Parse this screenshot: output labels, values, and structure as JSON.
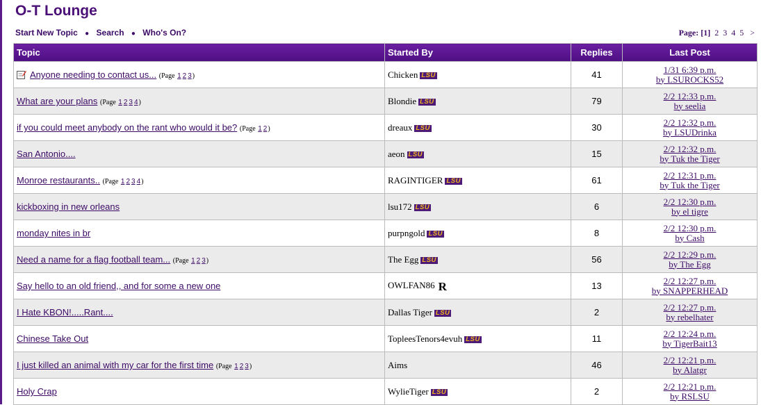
{
  "forum": {
    "title": "O-T Lounge"
  },
  "nav": {
    "start_new_topic": "Start New Topic",
    "search": "Search",
    "whos_on": "Who's On?",
    "separator": "●"
  },
  "pager": {
    "label": "Page:",
    "current": "[1]",
    "pages": [
      "2",
      "3",
      "4",
      "5"
    ],
    "next": ">"
  },
  "table": {
    "headers": {
      "topic": "Topic",
      "started_by": "Started By",
      "replies": "Replies",
      "last_post": "Last Post"
    }
  },
  "topics": [
    {
      "title": "Anyone needing to contact us...",
      "pages": [
        "1",
        "2",
        "3"
      ],
      "starter": "Chicken",
      "badge": "LSU",
      "replies": "41",
      "date": "1/31  6:39 p.m.",
      "by": "by LSUROCKS52",
      "icon": "note-pencil-icon"
    },
    {
      "title": "What are your plans",
      "pages": [
        "1",
        "2",
        "3",
        "4"
      ],
      "starter": "Blondie",
      "badge": "LSU",
      "replies": "79",
      "date": "2/2  12:33 p.m.",
      "by": "by seelia"
    },
    {
      "title": "if you could meet anybody on the rant who would it be?",
      "pages": [
        "1",
        "2"
      ],
      "starter": "dreaux",
      "badge": "LSU",
      "replies": "30",
      "date": "2/2  12:32 p.m.",
      "by": "by LSUDrinka"
    },
    {
      "title": "San Antonio....",
      "pages": [],
      "starter": "aeon",
      "badge": "LSU",
      "replies": "15",
      "date": "2/2  12:32 p.m.",
      "by": "by Tuk the Tiger"
    },
    {
      "title": "Monroe restaurants..",
      "pages": [
        "1",
        "2",
        "3",
        "4"
      ],
      "starter": "RAGINTIGER",
      "badge": "LSU",
      "replies": "61",
      "date": "2/2  12:31 p.m.",
      "by": "by Tuk the Tiger"
    },
    {
      "title": "kickboxing in new orleans",
      "pages": [],
      "starter": "lsu172",
      "badge": "LSU",
      "replies": "6",
      "date": "2/2  12:30 p.m.",
      "by": "by el tigre"
    },
    {
      "title": "monday nites in br",
      "pages": [],
      "starter": "purpngold",
      "badge": "LSU",
      "replies": "8",
      "date": "2/2  12:30 p.m.",
      "by": "by Cash"
    },
    {
      "title": "Need a name for a flag football team...",
      "pages": [
        "1",
        "2",
        "3"
      ],
      "starter": "The Egg",
      "badge": "LSU",
      "replies": "56",
      "date": "2/2  12:29 p.m.",
      "by": "by The Egg"
    },
    {
      "title": "Say hello to an old friend,, and for some a new one",
      "pages": [],
      "starter": "OWLFAN86",
      "badge": "R",
      "replies": "13",
      "date": "2/2  12:27 p.m.",
      "by": "by SNAPPERHEAD"
    },
    {
      "title": "I Hate KBON!.....Rant....",
      "pages": [],
      "starter": "Dallas Tiger",
      "badge": "LSU",
      "replies": "2",
      "date": "2/2  12:27 p.m.",
      "by": "by rebelhater"
    },
    {
      "title": "Chinese Take Out",
      "pages": [],
      "starter": "TopleesTenors4evuh",
      "badge": "LSU",
      "replies": "11",
      "date": "2/2  12:24 p.m.",
      "by": "by TigerBait13"
    },
    {
      "title": "I just killed an animal with my car for the first time",
      "pages": [
        "1",
        "2",
        "3"
      ],
      "starter": "Aims",
      "badge": "",
      "replies": "46",
      "date": "2/2  12:21 p.m.",
      "by": "by Alatgr"
    },
    {
      "title": "Holy Crap",
      "pages": [],
      "starter": "WylieTiger",
      "badge": "LSU",
      "replies": "2",
      "date": "2/2  12:21 p.m.",
      "by": "by RSLSU"
    }
  ],
  "page_label": "Page",
  "colors": {
    "header_purple": "#5b1a8a",
    "link": "#3c0a66",
    "badge_gold": "#f2b51d",
    "alt_row": "#ebebeb"
  }
}
